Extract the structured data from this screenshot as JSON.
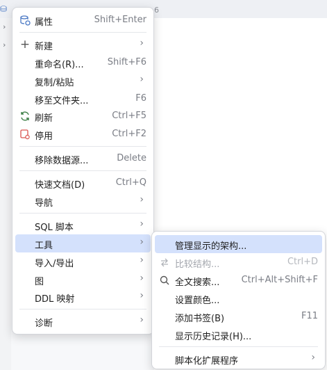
{
  "background": {
    "tab_fragment": "6"
  },
  "context_menu": {
    "groups": [
      [
        {
          "label": "属性",
          "shortcut": "Shift+Enter",
          "icon": "database-properties-icon"
        },
        {
          "separator": true
        },
        {
          "label": "新建",
          "submenu": true,
          "icon": "plus-icon"
        },
        {
          "label": "重命名(R)...",
          "shortcut": "Shift+F6"
        },
        {
          "label": "复制/粘贴",
          "submenu": true
        },
        {
          "label": "移至文件夹...",
          "shortcut": "F6"
        },
        {
          "label": "刷新",
          "shortcut": "Ctrl+F5",
          "icon": "refresh-icon"
        },
        {
          "label": "停用",
          "shortcut": "Ctrl+F2",
          "icon": "disconnect-icon"
        }
      ]
    ],
    "items": [
      {
        "label": "属性",
        "shortcut": "Shift+Enter"
      },
      {
        "label": "新建"
      },
      {
        "label": "重命名(R)...",
        "shortcut": "Shift+F6"
      },
      {
        "label": "复制/粘贴"
      },
      {
        "label": "移至文件夹...",
        "shortcut": "F6"
      },
      {
        "label": "刷新",
        "shortcut": "Ctrl+F5"
      },
      {
        "label": "停用",
        "shortcut": "Ctrl+F2"
      },
      {
        "label": "移除数据源...",
        "shortcut": "Delete"
      },
      {
        "label": "快速文档(D)",
        "shortcut": "Ctrl+Q"
      },
      {
        "label": "导航"
      },
      {
        "label": "SQL 脚本"
      },
      {
        "label": "工具"
      },
      {
        "label": "导入/导出"
      },
      {
        "label": "图"
      },
      {
        "label": "DDL 映射"
      },
      {
        "label": "诊断"
      }
    ]
  },
  "tools_submenu": {
    "items": [
      {
        "label": "管理显示的架构..."
      },
      {
        "label": "比较结构...",
        "shortcut": "Ctrl+D"
      },
      {
        "label": "全文搜索...",
        "shortcut": "Ctrl+Alt+Shift+F"
      },
      {
        "label": "设置颜色..."
      },
      {
        "label": "添加书签(B)",
        "shortcut": "F11"
      },
      {
        "label": "显示历史记录(H)..."
      },
      {
        "label": "脚本化扩展程序"
      }
    ]
  },
  "colors": {
    "highlight": "#d4e1fc",
    "refresh_icon": "#3a7d44",
    "stop_icon": "#d9534f",
    "db_icon": "#4a78c4"
  }
}
